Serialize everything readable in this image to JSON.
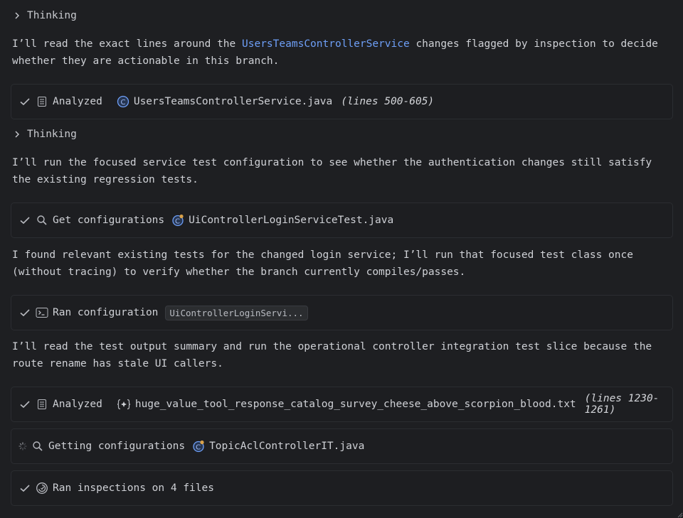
{
  "items": {
    "thinking1": "Thinking",
    "para1_pre": "I’ll read the exact lines around the ",
    "para1_link": "UsersTeamsControllerService",
    "para1_post": " changes flagged by inspection to decide whether they are actionable in this branch.",
    "card1": {
      "label": "Analyzed",
      "file": "UsersTeamsControllerService.java",
      "range": "(lines 500-605)"
    },
    "thinking2": "Thinking",
    "para2": "I’ll run the focused service test configuration to see whether the authentication changes still satisfy the existing regression tests.",
    "card2": {
      "label": "Get configurations",
      "file": "UiControllerLoginServiceTest.java"
    },
    "para3": "I found relevant existing tests for the changed login service; I’ll run that focused test class once (without tracing) to verify whether the branch currently compiles/passes.",
    "card3": {
      "label": "Ran configuration",
      "chip": "UiControllerLoginServi..."
    },
    "para4": "I’ll read the test output summary and run the operational controller integration test slice because the route rename has stale UI callers.",
    "card4": {
      "label": "Analyzed",
      "file": "huge_value_tool_response_catalog_survey_cheese_above_scorpion_blood.txt",
      "range": "(lines 1230-1261)"
    },
    "card5": {
      "label": "Getting configurations",
      "file": "TopicAclControllerIT.java"
    },
    "card6": {
      "label": "Ran inspections on 4 files"
    }
  },
  "colors": {
    "accent": "#6e9ff7",
    "background": "#1e1f22",
    "text": "#cfd1d6"
  }
}
